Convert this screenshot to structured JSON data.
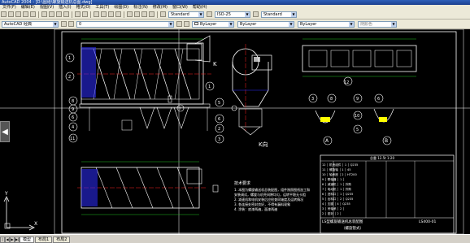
{
  "window": {
    "title": "AutoCAD 2004 - [D:\\图纸\\螺旋输送机总图.dwg]"
  },
  "menu": {
    "items": [
      "文件(F)",
      "编辑(E)",
      "视图(V)",
      "插入(I)",
      "格式(O)",
      "工具(T)",
      "绘图(D)",
      "标注(N)",
      "修改(M)",
      "窗口(W)",
      "帮助(H)"
    ]
  },
  "toolbar": {
    "workspace": "AutoCAD 经典",
    "text_style": "Standard",
    "dim_style": "ISO-25",
    "table_style": "Standard",
    "layer": "0",
    "color": "ByLayer",
    "linetype": "ByLayer",
    "lineweight": "ByLayer",
    "plotstyle": "随颜色"
  },
  "drawing": {
    "view_label_k": "K",
    "view_label_k_dir": "K向",
    "leaders_left": [
      "1",
      "2",
      "3",
      "4",
      "5",
      "6",
      "7",
      "8",
      "9",
      "10",
      "11"
    ],
    "leaders_front": [
      "1",
      "2",
      "3",
      "4",
      "5",
      "6",
      "7"
    ],
    "leader_12": "12",
    "detail_leaders": [
      "3",
      "8",
      "9",
      "10",
      "5",
      "6",
      "A",
      "B"
    ],
    "note_title": "技术要求",
    "note_lines": [
      "1. 本图为螺旋输送机总装配图，组件按照图纸加工和",
      "   安装调试，螺旋与机壳间隙均匀，运转平稳无卡阻",
      "2. 减速机和电机安装后应检查同轴度及运转情况",
      "3. 各连接处密封良好，不得有漏料现象",
      "4. 涂装：底漆两遍，面漆两遍"
    ],
    "title_block": {
      "header": "总重 12.5t  1:20",
      "name": "LS型螺旋输送机总装配图",
      "subname": "（螺旋管式）",
      "code": "LS400-01"
    },
    "bom_rows": [
      "12 │ 机壳组件 │ 1 │ Q235",
      "11 │ 螺旋轴 │ 1 │ 45",
      "10 │ 轴承座 │ 2 │ HT200",
      "9 │ 联轴器 │ 1 │",
      "8 │ 减速机 │ 1 │ 外购",
      "7 │ 电动机 │ 1 │ 外购",
      "6 │ 进料口 │ 1 │ Q235",
      "5 │ 出料口 │ 2 │ Q235",
      "4 │ 支腿 │ 4 │ Q235",
      "3 │ 吊轴承 │ 2 │",
      "2 │ 密封 │ 2 │",
      "1 │ 盖板 │ 6 │ Q235"
    ],
    "axis_x": "X",
    "axis_y": "Y"
  },
  "status": {
    "tabs": [
      "模型",
      "布局1",
      "布局2"
    ],
    "active_tab": "模型"
  },
  "colors": {
    "background": "#000000",
    "white_lines": "#ffffff",
    "red_centerlines": "#ff2020",
    "blue_fill": "#2d2dff",
    "yellow_hatch": "#ffff00",
    "cyan_lines": "#00ffff",
    "green_lines": "#20c020"
  }
}
